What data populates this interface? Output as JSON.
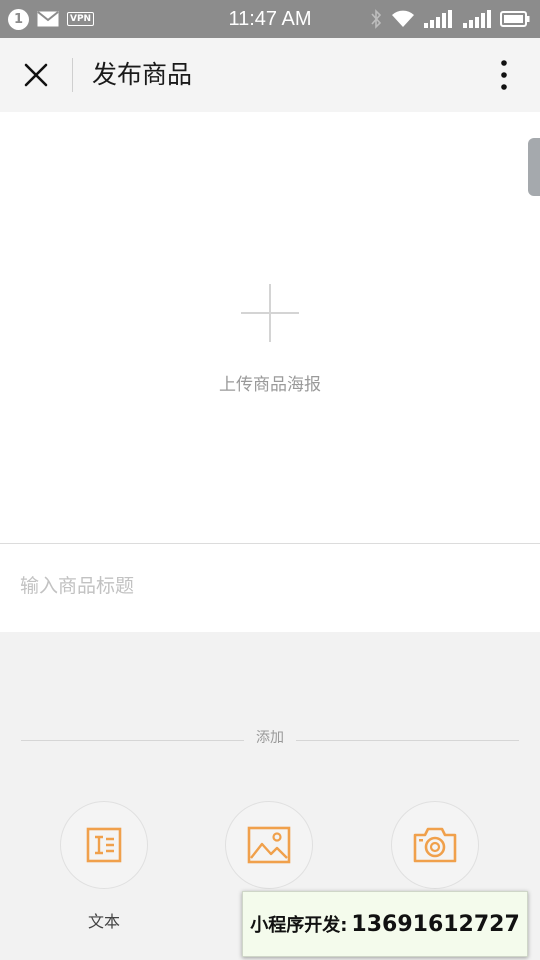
{
  "status_bar": {
    "notification_count": "1",
    "vpn_label": "VPN",
    "time": "11:47 AM",
    "icons": [
      "mail-icon",
      "bluetooth-icon",
      "wifi-icon",
      "signal-icon",
      "signal-icon",
      "battery-icon"
    ]
  },
  "navbar": {
    "title": "发布商品",
    "close_icon": "close-icon",
    "more_icon": "more-vertical-icon"
  },
  "poster": {
    "upload_label": "上传商品海报",
    "icon": "plus-icon"
  },
  "title_input": {
    "placeholder": "输入商品标题",
    "value": ""
  },
  "add_section": {
    "label": "添加",
    "buttons": [
      {
        "label": "文本",
        "icon": "text-icon"
      },
      {
        "label": "",
        "icon": "image-icon"
      },
      {
        "label": "",
        "icon": "camera-icon"
      }
    ]
  },
  "colors": {
    "accent": "#f0a04b",
    "status_bar": "#8c8c8c"
  },
  "watermark": {
    "label": "小程序开发:",
    "phone": "13691612727"
  }
}
